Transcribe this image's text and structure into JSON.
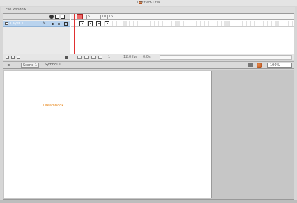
{
  "window": {
    "title": "Untitled-1.fla"
  },
  "menubar": {
    "items": [
      "File  Window"
    ]
  },
  "timeline": {
    "layers": [
      {
        "name": "Layer 1"
      }
    ],
    "frame_numbers": [
      "1",
      "5",
      "10",
      "15"
    ],
    "footer": {
      "current_frame": "1",
      "fps": "12.0 fps",
      "elapsed": "0.0s"
    }
  },
  "editbar": {
    "scene_label": "Scene 1",
    "symbol_label": "Symbol 1",
    "zoom": "100%"
  },
  "stage": {
    "text": "DreamBook"
  },
  "colors": {
    "accent": "#e88a20",
    "layer_highlight": "#b9d3ee",
    "playhead": "#e03030"
  }
}
